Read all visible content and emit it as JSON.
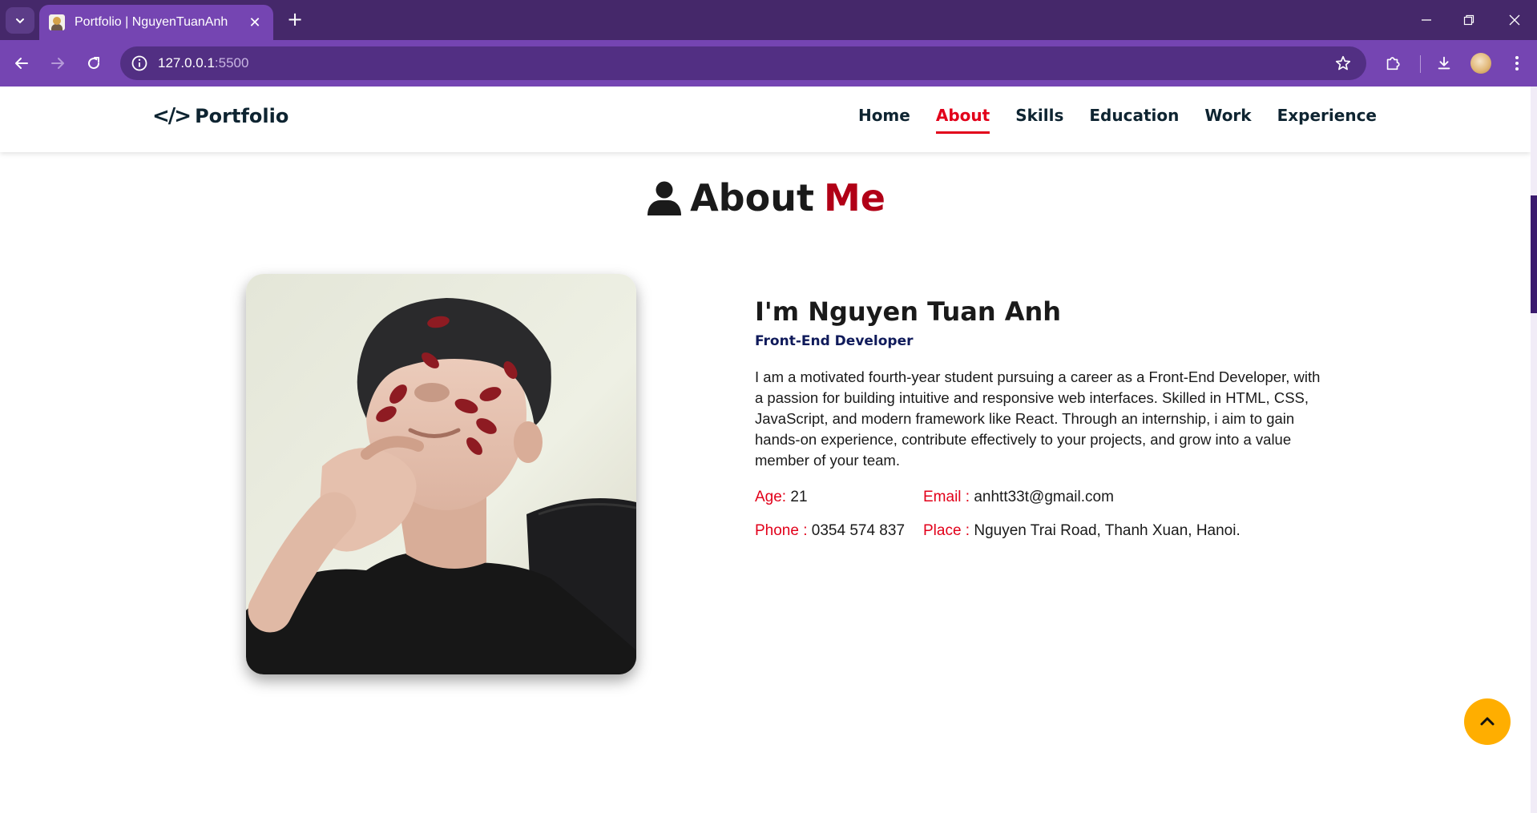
{
  "browser": {
    "tab_title": "Portfolio | NguyenTuanAnh",
    "url_host": "127.0.0.1",
    "url_port": ":5500"
  },
  "site": {
    "logo_code": "</>",
    "logo_text": "Portfolio",
    "nav": [
      {
        "label": "Home"
      },
      {
        "label": "About"
      },
      {
        "label": "Skills"
      },
      {
        "label": "Education"
      },
      {
        "label": "Work"
      },
      {
        "label": "Experience"
      }
    ],
    "active_nav": "About"
  },
  "about": {
    "heading_main": "About",
    "heading_accent": "Me",
    "name": "I'm Nguyen Tuan Anh",
    "role": "Front-End Developer",
    "bio": "I am a motivated fourth-year student pursuing a career as a Front-End Developer, with a passion for building intuitive and responsive web interfaces. Skilled in HTML, CSS, JavaScript, and modern framework like React. Through an internship, i aim to gain hands-on experience, contribute effectively to your projects, and grow into a value member of your team.",
    "facts": {
      "age_label": "Age:",
      "age_value": "21",
      "email_label": "Email :",
      "email_value": "anhtt33t@gmail.com",
      "phone_label": "Phone :",
      "phone_value": "0354 574 837",
      "place_label": "Place :",
      "place_value": "Nguyen Trai Road, Thanh Xuan, Hanoi."
    }
  },
  "colors": {
    "accent": "#e2001a",
    "heading_accent": "#b10016",
    "browser_frame": "#7545b2",
    "scroll_top_button": "#ffae00"
  }
}
